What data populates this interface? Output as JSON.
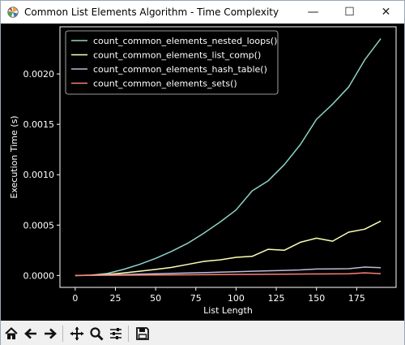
{
  "window": {
    "title": "Common List Elements Algorithm - Time Complexity",
    "controls": {
      "minimize": "—",
      "maximize": "☐",
      "close": "✕"
    }
  },
  "toolbar": {
    "buttons": [
      "home-icon",
      "back-arrow-icon",
      "forward-arrow-icon",
      "pan-icon",
      "zoom-icon",
      "configure-subplots-icon",
      "save-icon"
    ]
  },
  "chart_data": {
    "type": "line",
    "title": "",
    "xlabel": "List Length",
    "ylabel": "Execution Time (s)",
    "xlim": [
      -9.5,
      199.5
    ],
    "ylim": [
      -0.000118,
      0.002468
    ],
    "xticks": [
      0,
      25,
      50,
      75,
      100,
      125,
      150,
      175
    ],
    "xtick_labels": [
      "0",
      "25",
      "50",
      "75",
      "100",
      "125",
      "150",
      "175"
    ],
    "yticks": [
      0.0,
      0.0005,
      0.001,
      0.0015,
      0.002
    ],
    "ytick_labels": [
      "0.0000",
      "0.0005",
      "0.0010",
      "0.0015",
      "0.0020"
    ],
    "legend_position": "upper left",
    "background": "#000000",
    "foreground": "#ffffff",
    "x": [
      0,
      10,
      20,
      30,
      40,
      50,
      60,
      70,
      80,
      90,
      100,
      110,
      120,
      130,
      140,
      150,
      160,
      170,
      180,
      190
    ],
    "series": [
      {
        "name": "count_common_elements_nested_loops()",
        "color": "#8dd3c7",
        "values": [
          0.0,
          4e-06,
          2e-05,
          6e-05,
          0.00011,
          0.00017,
          0.00024,
          0.00032,
          0.00042,
          0.00053,
          0.00065,
          0.00084,
          0.00094,
          0.0011,
          0.0013,
          0.00155,
          0.0017,
          0.00187,
          0.00214,
          0.00235
        ]
      },
      {
        "name": "count_common_elements_list_comp()",
        "color": "#feffb3",
        "values": [
          0.0,
          2e-06,
          1e-05,
          2.5e-05,
          4.2e-05,
          6e-05,
          8e-05,
          0.00011,
          0.00014,
          0.000155,
          0.00018,
          0.00019,
          0.00026,
          0.00025,
          0.00033,
          0.00037,
          0.00034,
          0.00043,
          0.00046,
          0.00054
        ]
      },
      {
        "name": "count_common_elements_hash_table()",
        "color": "#bfbbd9",
        "values": [
          0.0,
          2e-06,
          5e-06,
          9e-06,
          1.3e-05,
          1.7e-05,
          2.1e-05,
          2.5e-05,
          2.9e-05,
          3.3e-05,
          3.7e-05,
          4.2e-05,
          4.6e-05,
          5e-05,
          5.5e-05,
          6.4e-05,
          6.6e-05,
          6.7e-05,
          8.3e-05,
          7.8e-05
        ]
      },
      {
        "name": "count_common_elements_sets()",
        "color": "#fa8174",
        "values": [
          0.0,
          1e-06,
          2e-06,
          3e-06,
          4e-06,
          5e-06,
          6e-06,
          7e-06,
          8e-06,
          9e-06,
          1e-05,
          1.1e-05,
          1.2e-05,
          1.3e-05,
          1.4e-05,
          1.5e-05,
          1.6e-05,
          1.7e-05,
          2.6e-05,
          1.8e-05
        ]
      }
    ]
  }
}
